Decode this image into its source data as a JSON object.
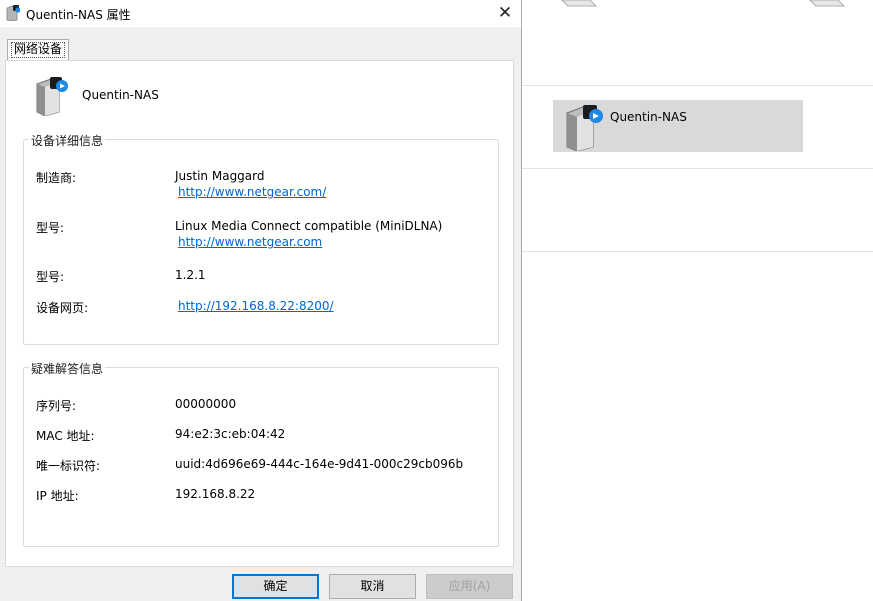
{
  "window": {
    "title": "Quentin-NAS 属性",
    "icon": "nas-device-icon"
  },
  "tabs": [
    {
      "label": "网络设备",
      "active": true
    }
  ],
  "device": {
    "name": "Quentin-NAS",
    "icon": "nas-device-icon"
  },
  "details": {
    "title": "设备详细信息",
    "manufacturer_label": "制造商:",
    "manufacturer": "Justin Maggard",
    "manufacturer_url": "http://www.netgear.com/",
    "model_label": "型号:",
    "model": "Linux Media Connect compatible (MiniDLNA)",
    "model_url": "http://www.netgear.com",
    "version_label": "型号:",
    "version": "1.2.1",
    "webpage_label": "设备网页:",
    "webpage_url": "http://192.168.8.22:8200/"
  },
  "troubleshoot": {
    "title": "疑难解答信息",
    "serial_label": "序列号:",
    "serial": "00000000",
    "mac_label": "MAC 地址:",
    "mac": "94:e2:3c:eb:04:42",
    "uid_label": "唯一标识符:",
    "uid": "uuid:4d696e69-444c-164e-9d41-000c29cb096b",
    "ip_label": "IP 地址:",
    "ip": "192.168.8.22"
  },
  "buttons": {
    "ok": "确定",
    "cancel": "取消",
    "apply": "应用(A)"
  },
  "background": {
    "tile_label": "Quentin-NAS"
  },
  "colors": {
    "link": "#0066cc",
    "focus_border": "#0078d7",
    "selection": "#d9d9d9"
  }
}
